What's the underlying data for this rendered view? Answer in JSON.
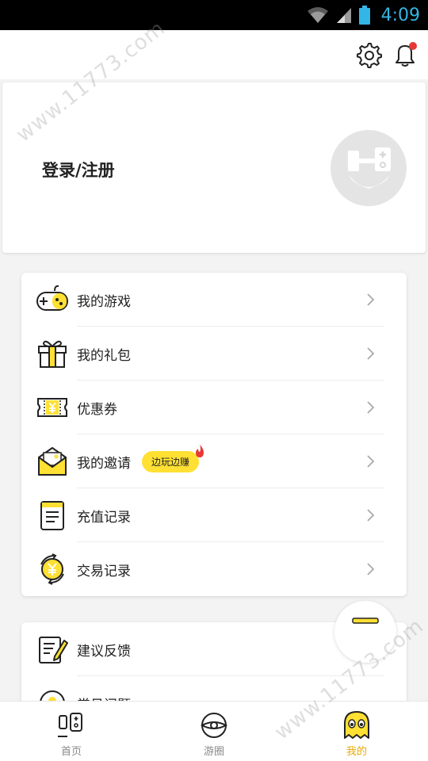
{
  "status_bar": {
    "time": "4:09"
  },
  "profile": {
    "login_label": "登录/注册"
  },
  "menu_main": {
    "items": [
      {
        "label": "我的游戏"
      },
      {
        "label": "我的礼包"
      },
      {
        "label": "优惠券"
      },
      {
        "label": "我的邀请",
        "badge": "边玩边赚"
      },
      {
        "label": "充值记录"
      },
      {
        "label": "交易记录"
      }
    ]
  },
  "menu_secondary": {
    "items": [
      {
        "label": "建议反馈"
      },
      {
        "label": "常见问题"
      }
    ]
  },
  "bottom_nav": {
    "items": [
      {
        "label": "首页"
      },
      {
        "label": "游圈"
      },
      {
        "label": "我的"
      }
    ],
    "active": "我的"
  },
  "watermark": {
    "text": "www.11773.com"
  },
  "colors": {
    "accent": "#ffe033",
    "active_tab": "#e8a900",
    "notification_dot": "#e53935"
  },
  "icons": {
    "status": [
      "wifi-icon",
      "signal-icon",
      "battery-icon"
    ],
    "top_bar": [
      "settings-icon",
      "bell-icon"
    ]
  }
}
